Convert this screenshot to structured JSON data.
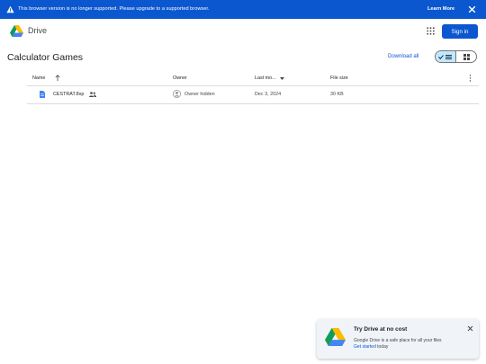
{
  "banner": {
    "message": "This browser version is no longer supported. Please upgrade to a supported browser.",
    "learn_more": "Learn More",
    "warn_icon": "warning-icon",
    "close_icon": "close-icon"
  },
  "header": {
    "brand": "Drive",
    "sign_in": "Sign in",
    "apps_icon": "apps-grid-icon"
  },
  "folder": {
    "title": "Calculator Games",
    "download_all": "Download all",
    "view_modes": [
      "list",
      "grid"
    ],
    "active_view": "list"
  },
  "table": {
    "columns": {
      "name": "Name",
      "owner": "Owner",
      "modified": "Last mo...",
      "size": "File size"
    },
    "rows": [
      {
        "name": "CESTRAT.8xp",
        "owner": "Owner hidden",
        "modified": "Dec 3, 2024",
        "size": "30 KB",
        "shared": true
      }
    ]
  },
  "promo": {
    "title": "Try Drive at no cost",
    "body": "Google Drive is a safe place for all your files",
    "link": "Get started",
    "link_suffix": "today"
  },
  "colors": {
    "accent": "#0b57d0",
    "toggle_active": "#c2e7ff",
    "promo_bg": "#f0f4f9"
  }
}
